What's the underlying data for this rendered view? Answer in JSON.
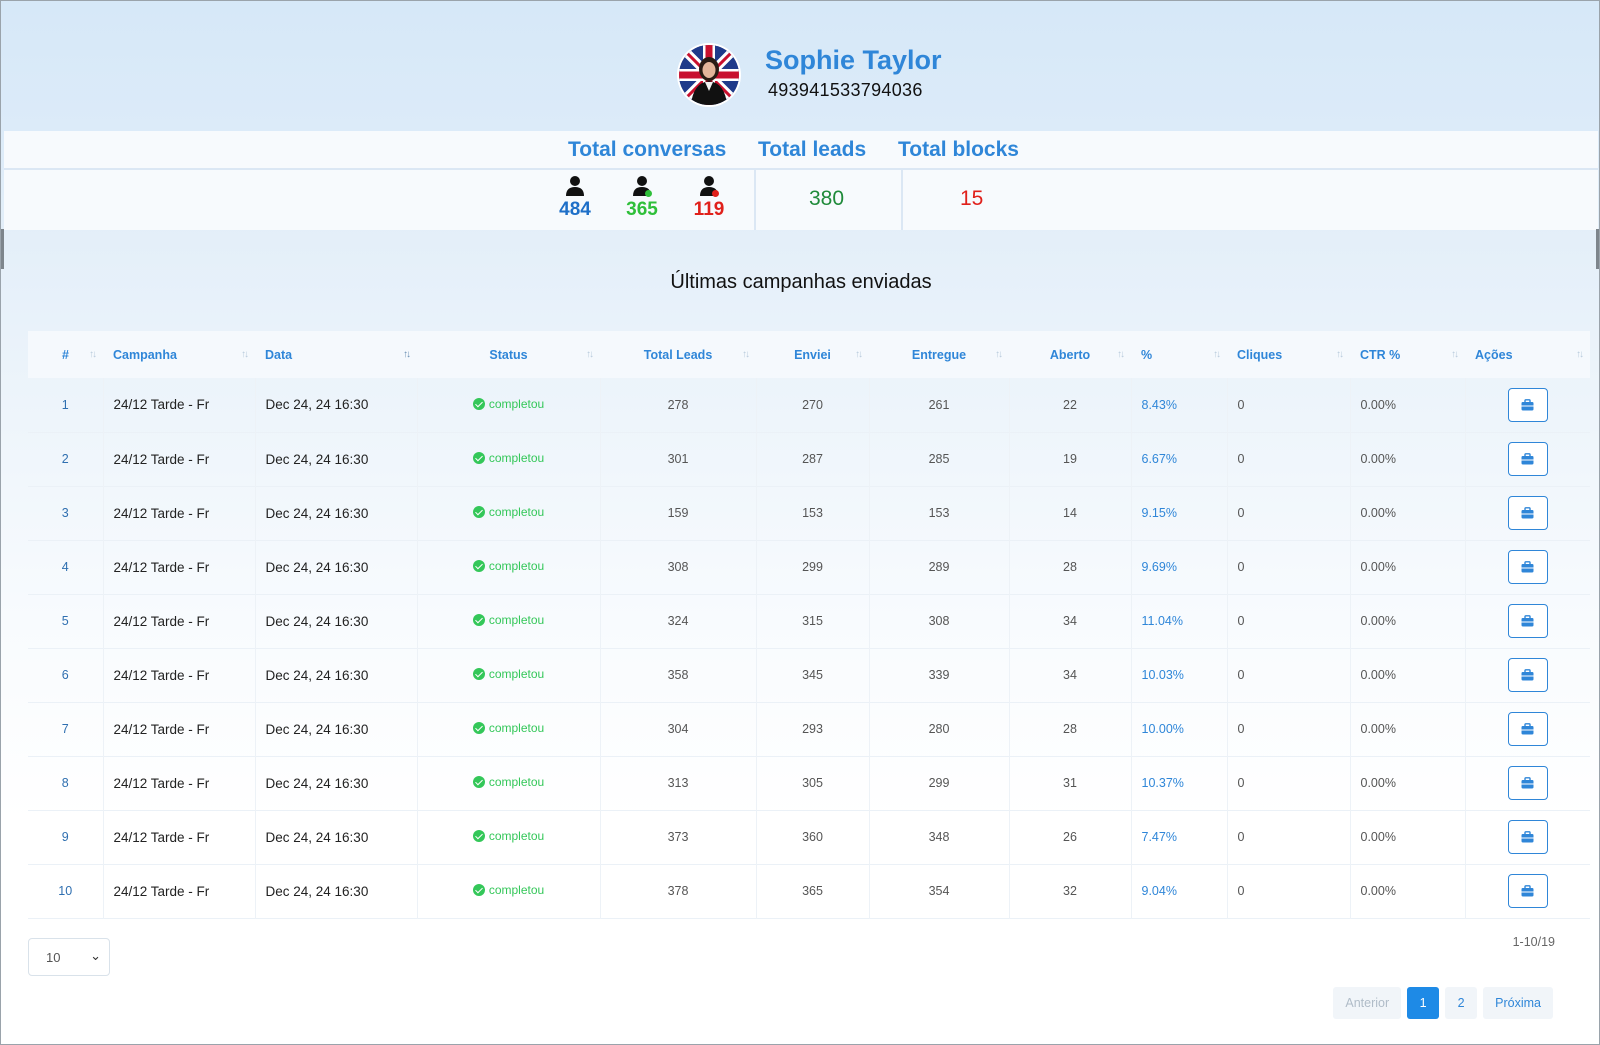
{
  "profile": {
    "name": "Sophie Taylor",
    "phone": "493941533794036"
  },
  "stats": {
    "labels": {
      "conversas": "Total conversas",
      "leads": "Total leads",
      "blocks": "Total blocks"
    },
    "conversas": {
      "total": "484",
      "positive": "365",
      "negative": "119"
    },
    "leads": "380",
    "blocks": "15",
    "colors": {
      "total": "#1e6fc8",
      "positive": "#2fbf3a",
      "negative": "#e0201b",
      "leads": "#1f8a3a",
      "blocks": "#e0201b"
    }
  },
  "section_title": "Últimas campanhas enviadas",
  "table": {
    "columns": [
      "#",
      "Campanha",
      "Data",
      "Status",
      "Total Leads",
      "Enviei",
      "Entregue",
      "Aberto",
      "%",
      "Cliques",
      "CTR %",
      "Ações"
    ],
    "rows": [
      {
        "n": "1",
        "campanha": "24/12 Tarde - Fr",
        "data": "Dec 24, 24 16:30",
        "status": "completou",
        "total": "278",
        "enviei": "270",
        "entregue": "261",
        "aberto": "22",
        "pct": "8.43%",
        "cliques": "0",
        "ctr": "0.00%"
      },
      {
        "n": "2",
        "campanha": "24/12 Tarde - Fr",
        "data": "Dec 24, 24 16:30",
        "status": "completou",
        "total": "301",
        "enviei": "287",
        "entregue": "285",
        "aberto": "19",
        "pct": "6.67%",
        "cliques": "0",
        "ctr": "0.00%"
      },
      {
        "n": "3",
        "campanha": "24/12 Tarde - Fr",
        "data": "Dec 24, 24 16:30",
        "status": "completou",
        "total": "159",
        "enviei": "153",
        "entregue": "153",
        "aberto": "14",
        "pct": "9.15%",
        "cliques": "0",
        "ctr": "0.00%"
      },
      {
        "n": "4",
        "campanha": "24/12 Tarde - Fr",
        "data": "Dec 24, 24 16:30",
        "status": "completou",
        "total": "308",
        "enviei": "299",
        "entregue": "289",
        "aberto": "28",
        "pct": "9.69%",
        "cliques": "0",
        "ctr": "0.00%"
      },
      {
        "n": "5",
        "campanha": "24/12 Tarde - Fr",
        "data": "Dec 24, 24 16:30",
        "status": "completou",
        "total": "324",
        "enviei": "315",
        "entregue": "308",
        "aberto": "34",
        "pct": "11.04%",
        "cliques": "0",
        "ctr": "0.00%"
      },
      {
        "n": "6",
        "campanha": "24/12 Tarde - Fr",
        "data": "Dec 24, 24 16:30",
        "status": "completou",
        "total": "358",
        "enviei": "345",
        "entregue": "339",
        "aberto": "34",
        "pct": "10.03%",
        "cliques": "0",
        "ctr": "0.00%"
      },
      {
        "n": "7",
        "campanha": "24/12 Tarde - Fr",
        "data": "Dec 24, 24 16:30",
        "status": "completou",
        "total": "304",
        "enviei": "293",
        "entregue": "280",
        "aberto": "28",
        "pct": "10.00%",
        "cliques": "0",
        "ctr": "0.00%"
      },
      {
        "n": "8",
        "campanha": "24/12 Tarde - Fr",
        "data": "Dec 24, 24 16:30",
        "status": "completou",
        "total": "313",
        "enviei": "305",
        "entregue": "299",
        "aberto": "31",
        "pct": "10.37%",
        "cliques": "0",
        "ctr": "0.00%"
      },
      {
        "n": "9",
        "campanha": "24/12 Tarde - Fr",
        "data": "Dec 24, 24 16:30",
        "status": "completou",
        "total": "373",
        "enviei": "360",
        "entregue": "348",
        "aberto": "26",
        "pct": "7.47%",
        "cliques": "0",
        "ctr": "0.00%"
      },
      {
        "n": "10",
        "campanha": "24/12 Tarde - Fr",
        "data": "Dec 24, 24 16:30",
        "status": "completou",
        "total": "378",
        "enviei": "365",
        "entregue": "354",
        "aberto": "32",
        "pct": "9.04%",
        "cliques": "0",
        "ctr": "0.00%"
      }
    ],
    "action_icon": "briefcase-icon"
  },
  "footer": {
    "page_size": "10",
    "range": "1-10/19",
    "prev": "Anterior",
    "pages": [
      "1",
      "2"
    ],
    "current_page": "1",
    "next": "Próxima"
  }
}
